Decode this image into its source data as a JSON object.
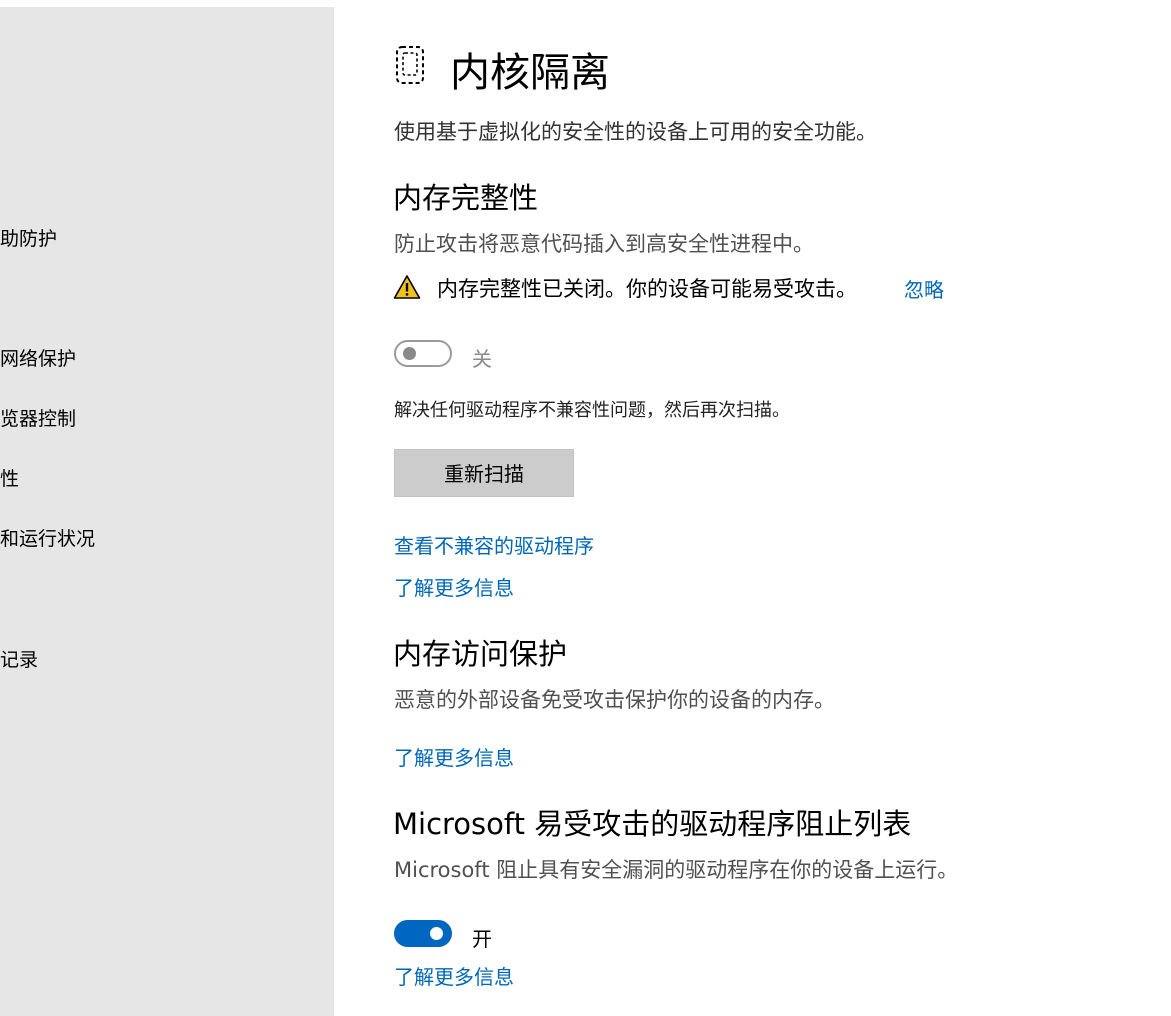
{
  "sidebar": {
    "items": [
      {
        "label": "助防护"
      },
      {
        "label": "网络保护"
      },
      {
        "label": "览器控制"
      },
      {
        "label": "性"
      },
      {
        "label": "和运行状况"
      },
      {
        "label": "记录"
      }
    ]
  },
  "page": {
    "title": "内核隔离",
    "description": "使用基于虚拟化的安全性的设备上可用的安全功能。",
    "title_icon": "core-isolation-icon"
  },
  "memory_integrity": {
    "heading": "内存完整性",
    "subtitle": "防止攻击将恶意代码插入到高安全性进程中。",
    "warning": "内存完整性已关闭。你的设备可能易受攻击。",
    "warning_icon": "warning-icon",
    "dismiss_label": "忽略",
    "toggle_label": "关",
    "toggle_state": "off",
    "driver_note": "解决任何驱动程序不兼容性问题，然后再次扫描。",
    "rescan_label": "重新扫描",
    "view_drivers_link": "查看不兼容的驱动程序",
    "learn_more_link": "了解更多信息"
  },
  "memory_access": {
    "heading": "内存访问保护",
    "subtitle": "恶意的外部设备免受攻击保护你的设备的内存。",
    "learn_more_link": "了解更多信息"
  },
  "blocklist": {
    "heading": "Microsoft 易受攻击的驱动程序阻止列表",
    "subtitle": "Microsoft 阻止具有安全漏洞的驱动程序在你的设备上运行。",
    "toggle_label": "开",
    "toggle_state": "on",
    "learn_more_link": "了解更多信息"
  },
  "colors": {
    "accent": "#0067c0",
    "link": "#0067b8",
    "warning": "#f2c21b",
    "sidebar_bg": "#e6e6e6"
  }
}
